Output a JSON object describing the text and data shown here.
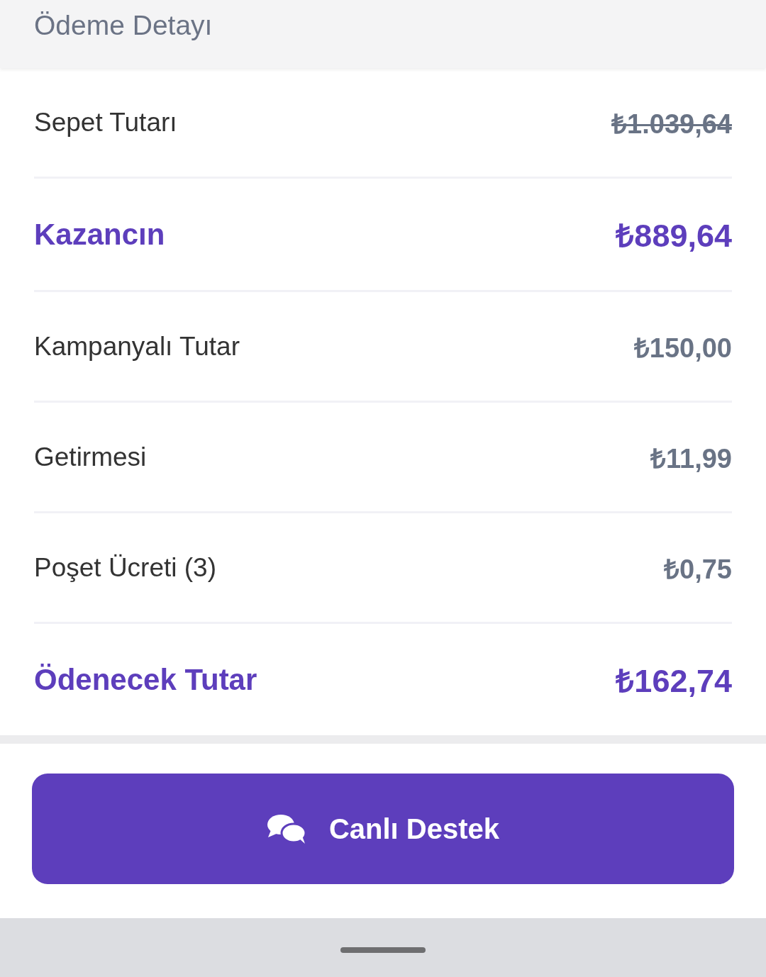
{
  "header": {
    "title": "Ödeme Detayı"
  },
  "rows": [
    {
      "label": "Sepet Tutarı",
      "value": "₺1.039,64",
      "kind": "normal",
      "struck": true
    },
    {
      "label": "Kazancın",
      "value": "₺889,64",
      "kind": "highlight",
      "struck": false
    },
    {
      "label": "Kampanyalı Tutar",
      "value": "₺150,00",
      "kind": "normal",
      "struck": false
    },
    {
      "label": "Getirmesi",
      "value": "₺11,99",
      "kind": "normal",
      "struck": false
    },
    {
      "label": "Poşet Ücreti (3)",
      "value": "₺0,75",
      "kind": "normal",
      "struck": false
    },
    {
      "label": "Ödenecek Tutar",
      "value": "₺162,74",
      "kind": "highlight",
      "struck": false
    }
  ],
  "support_button": {
    "label": "Canlı Destek"
  }
}
